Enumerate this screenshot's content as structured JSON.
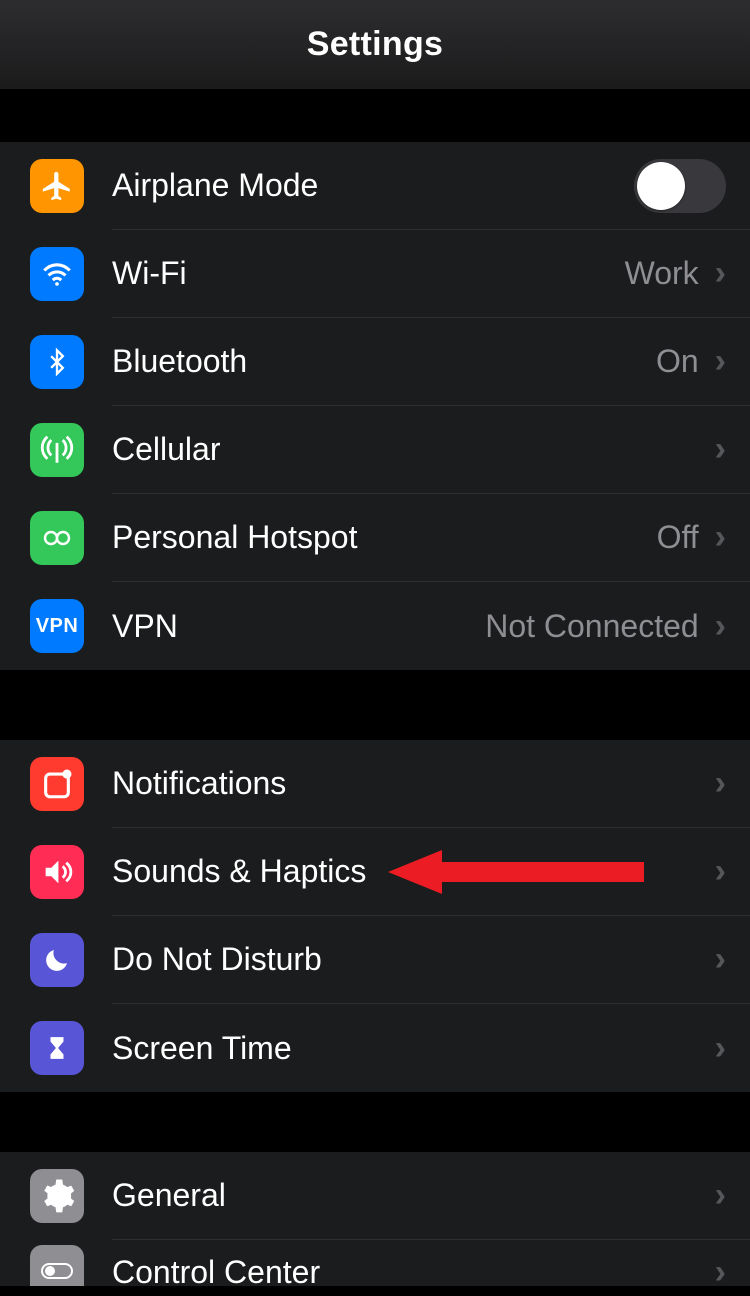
{
  "header": {
    "title": "Settings"
  },
  "group1": {
    "airplane": {
      "label": "Airplane Mode"
    },
    "wifi": {
      "label": "Wi-Fi",
      "value": "Work"
    },
    "bluetooth": {
      "label": "Bluetooth",
      "value": "On"
    },
    "cellular": {
      "label": "Cellular"
    },
    "hotspot": {
      "label": "Personal Hotspot",
      "value": "Off"
    },
    "vpn": {
      "label": "VPN",
      "value": "Not Connected"
    }
  },
  "group2": {
    "notifications": {
      "label": "Notifications"
    },
    "sounds": {
      "label": "Sounds & Haptics"
    },
    "dnd": {
      "label": "Do Not Disturb"
    },
    "screentime": {
      "label": "Screen Time"
    }
  },
  "group3": {
    "general": {
      "label": "General"
    },
    "controlcenter": {
      "label": "Control Center"
    }
  }
}
